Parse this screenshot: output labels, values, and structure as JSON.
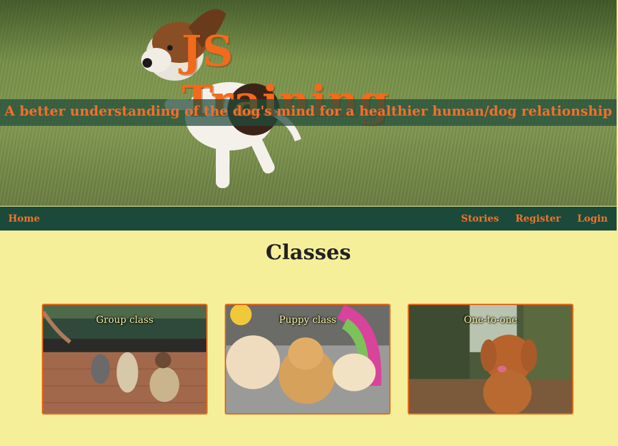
{
  "header": {
    "title": "JS Training",
    "tagline": "A better understanding of the dog's mind for a healthier human/dog relationship"
  },
  "nav": {
    "home": "Home",
    "links": [
      "Stories",
      "Register",
      "Login"
    ]
  },
  "main": {
    "section_title": "Classes",
    "classes": [
      {
        "label": "Group class"
      },
      {
        "label": "Puppy class"
      },
      {
        "label": "One-to-one"
      }
    ]
  },
  "colors": {
    "accent_orange": "#f26a1b",
    "nav_green": "#1b4a3b",
    "page_background": "#f5ef9a"
  }
}
